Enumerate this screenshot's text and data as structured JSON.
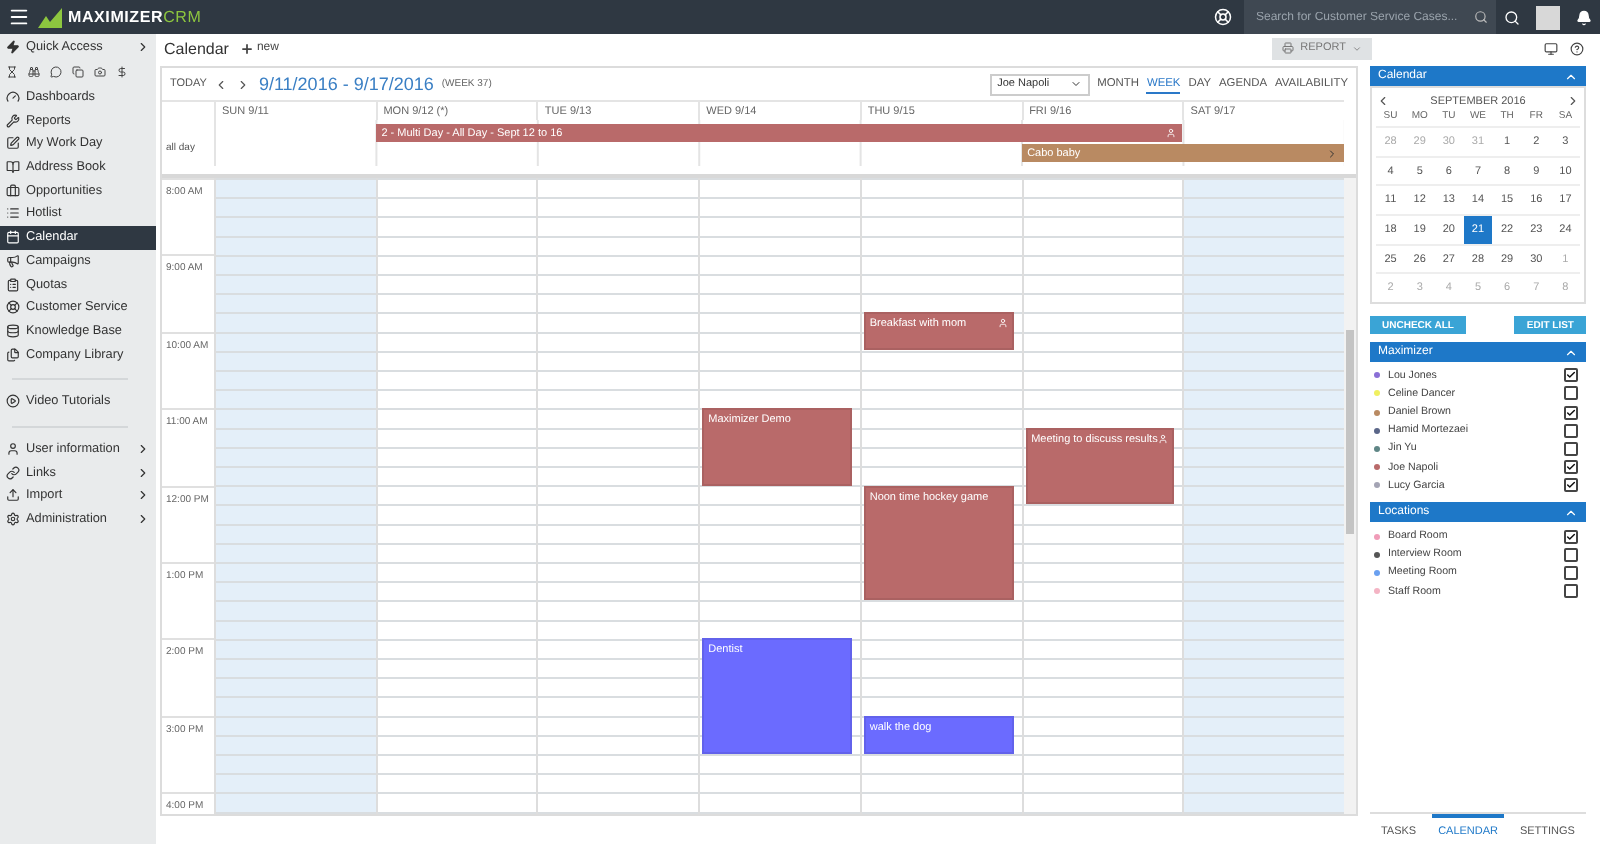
{
  "top_bar": {
    "logo_name": "MAXIMIZER",
    "logo_suffix": "CRM",
    "search": {
      "placeholder": "Search for Customer Service Cases..."
    }
  },
  "sidebar": {
    "quick_access": "Quick Access",
    "items": [
      {
        "label": "Dashboards",
        "selected": false
      },
      {
        "label": "Reports",
        "selected": false
      },
      {
        "label": "My Work Day",
        "selected": false
      },
      {
        "label": "Address Book",
        "selected": false
      },
      {
        "label": "Opportunities",
        "selected": false
      },
      {
        "label": "Hotlist",
        "selected": false
      },
      {
        "label": "Calendar",
        "selected": true
      },
      {
        "label": "Campaigns",
        "selected": false
      },
      {
        "label": "Quotas",
        "selected": false
      },
      {
        "label": "Customer Service",
        "selected": false
      },
      {
        "label": "Knowledge Base",
        "selected": false
      },
      {
        "label": "Company Library",
        "selected": false
      }
    ],
    "tools": [
      "Video Tutorials"
    ],
    "menus": [
      "User information",
      "Links",
      "Import",
      "Administration"
    ]
  },
  "page": {
    "title": "Calendar",
    "new_button": "new",
    "report_button": "REPORT"
  },
  "calendar": {
    "today_button": "TODAY",
    "range": "9/11/2016 - 9/17/2016",
    "week": "(WEEK 37)",
    "user_select": "Joe Napoli",
    "views": [
      {
        "label": "MONTH",
        "selected": false
      },
      {
        "label": "WEEK",
        "selected": true
      },
      {
        "label": "DAY",
        "selected": false
      },
      {
        "label": "AGENDA",
        "selected": false
      },
      {
        "label": "AVAILABILITY",
        "selected": false
      }
    ],
    "all_day_label": "all day",
    "hours": [
      "8:00 AM",
      "9:00 AM",
      "10:00 AM",
      "11:00 AM",
      "12:00 PM",
      "1:00 PM",
      "2:00 PM",
      "3:00 PM",
      "4:00 PM"
    ],
    "days": [
      {
        "label": "SUN 9/11",
        "shaded": true
      },
      {
        "label": "MON 9/12 (*)",
        "shaded": false,
        "all_day_events": [
          {
            "title": "2 - Multi Day - All Day - Sept 12 to 16",
            "color": "#b96a6a",
            "kind": "personal"
          }
        ]
      },
      {
        "label": "TUE 9/13",
        "shaded": false
      },
      {
        "label": "WED 9/14",
        "shaded": false,
        "events": [
          {
            "title": "Maximizer Demo",
            "color": "#b96a6a",
            "kind": "plain"
          },
          {
            "title": "Dentist",
            "color": "#6b6bff",
            "kind": "plain"
          }
        ]
      },
      {
        "label": "THU 9/15",
        "shaded": false,
        "events": [
          {
            "title": "Breakfast with mom",
            "color": "#b96a6a",
            "kind": "personal"
          },
          {
            "title": "Noon time hockey game",
            "color": "#b96a6a",
            "kind": "plain"
          },
          {
            "title": "walk the dog",
            "color": "#6b6bff",
            "kind": "plain"
          }
        ]
      },
      {
        "label": "FRI 9/16",
        "shaded": false,
        "all_day_events": [
          {
            "title": "Cabo baby",
            "color": "#b98a62",
            "kind": "continued"
          }
        ],
        "events": [
          {
            "title": "Meeting to discuss results",
            "color": "#b96a6a",
            "kind": "personal"
          }
        ]
      },
      {
        "label": "SAT 9/17",
        "shaded": true
      }
    ]
  },
  "side_panel": {
    "title": "Calendar",
    "expanded": true,
    "month": "SEPTEMBER 2016",
    "weekdays": [
      "SU",
      "MO",
      "TU",
      "WE",
      "TH",
      "FR",
      "SA"
    ],
    "weeks": [
      [
        {
          "day": "28",
          "muted": true,
          "selected": false
        },
        {
          "day": "29",
          "muted": true,
          "selected": false
        },
        {
          "day": "30",
          "muted": true,
          "selected": false
        },
        {
          "day": "31",
          "muted": true,
          "selected": false
        },
        {
          "day": "1",
          "muted": false,
          "selected": false
        },
        {
          "day": "2",
          "muted": false,
          "selected": false
        },
        {
          "day": "3",
          "muted": false,
          "selected": false
        }
      ],
      [
        {
          "day": "4",
          "muted": false,
          "selected": false
        },
        {
          "day": "5",
          "muted": false,
          "selected": false
        },
        {
          "day": "6",
          "muted": false,
          "selected": false
        },
        {
          "day": "7",
          "muted": false,
          "selected": false
        },
        {
          "day": "8",
          "muted": false,
          "selected": false
        },
        {
          "day": "9",
          "muted": false,
          "selected": false
        },
        {
          "day": "10",
          "muted": false,
          "selected": false
        }
      ],
      [
        {
          "day": "11",
          "muted": false,
          "selected": false
        },
        {
          "day": "12",
          "muted": false,
          "selected": false
        },
        {
          "day": "13",
          "muted": false,
          "selected": false
        },
        {
          "day": "14",
          "muted": false,
          "selected": false
        },
        {
          "day": "15",
          "muted": false,
          "selected": false
        },
        {
          "day": "16",
          "muted": false,
          "selected": false
        },
        {
          "day": "17",
          "muted": false,
          "selected": false
        }
      ],
      [
        {
          "day": "18",
          "muted": false,
          "selected": false
        },
        {
          "day": "19",
          "muted": false,
          "selected": false
        },
        {
          "day": "20",
          "muted": false,
          "selected": false
        },
        {
          "day": "21",
          "muted": false,
          "selected": true
        },
        {
          "day": "22",
          "muted": false,
          "selected": false
        },
        {
          "day": "23",
          "muted": false,
          "selected": false
        },
        {
          "day": "24",
          "muted": false,
          "selected": false
        }
      ],
      [
        {
          "day": "25",
          "muted": false,
          "selected": false
        },
        {
          "day": "26",
          "muted": false,
          "selected": false
        },
        {
          "day": "27",
          "muted": false,
          "selected": false
        },
        {
          "day": "28",
          "muted": false,
          "selected": false
        },
        {
          "day": "29",
          "muted": false,
          "selected": false
        },
        {
          "day": "30",
          "muted": false,
          "selected": false
        },
        {
          "day": "1",
          "muted": true,
          "selected": false
        }
      ],
      [
        {
          "day": "2",
          "muted": true,
          "selected": false
        },
        {
          "day": "3",
          "muted": true,
          "selected": false
        },
        {
          "day": "4",
          "muted": true,
          "selected": false
        },
        {
          "day": "5",
          "muted": true,
          "selected": false
        },
        {
          "day": "6",
          "muted": true,
          "selected": false
        },
        {
          "day": "7",
          "muted": true,
          "selected": false
        },
        {
          "day": "8",
          "muted": true,
          "selected": false
        }
      ]
    ],
    "buttons": [
      "UNCHECK ALL",
      "EDIT LIST"
    ],
    "groups": [
      {
        "title": "Maximizer",
        "expanded": true,
        "items": [
          {
            "name": "Lou Jones",
            "color": "#8a6fd6",
            "checked": true
          },
          {
            "name": "Celine Dancer",
            "color": "#f0f060",
            "checked": false
          },
          {
            "name": "Daniel Brown",
            "color": "#b98a62",
            "checked": true
          },
          {
            "name": "Hamid Mortezaei",
            "color": "#5a6688",
            "checked": false
          },
          {
            "name": "Jin Yu",
            "color": "#5f8686",
            "checked": false
          },
          {
            "name": "Joe Napoli",
            "color": "#b96a6a",
            "checked": true
          },
          {
            "name": "Lucy Garcia",
            "color": "#a4a4b4",
            "checked": true
          }
        ]
      },
      {
        "title": "Locations",
        "expanded": true,
        "items": [
          {
            "name": "Board Room",
            "color": "#f09cb8",
            "checked": true
          },
          {
            "name": "Interview Room",
            "color": "#555555",
            "checked": false
          },
          {
            "name": "Meeting Room",
            "color": "#6aa0f0",
            "checked": false
          },
          {
            "name": "Staff Room",
            "color": "#f4b4c4",
            "checked": false
          }
        ]
      }
    ],
    "tabs": [
      {
        "label": "TASKS",
        "selected": false
      },
      {
        "label": "CALENDAR",
        "selected": true
      },
      {
        "label": "SETTINGS",
        "selected": false
      }
    ]
  }
}
